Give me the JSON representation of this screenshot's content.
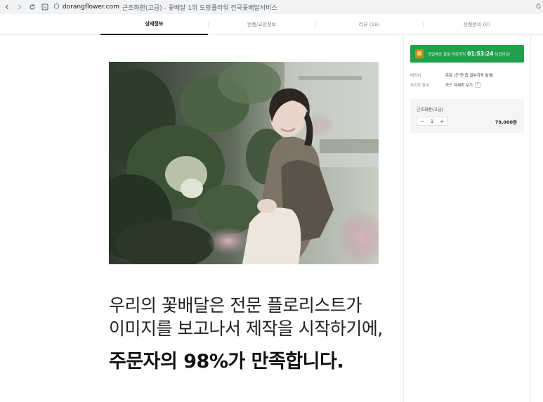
{
  "browser": {
    "domain": "dorangflower.com",
    "tab_title": "근조화환(고급) - 꽃배달 1위 도랑플라워 전국꽃배달서비스",
    "info_icon": "info-icon",
    "edge_letter": "G"
  },
  "tabs": [
    {
      "label": "상세정보",
      "active": true
    },
    {
      "label": "반품/교환정보",
      "active": false
    },
    {
      "label": "리뷰 (18)",
      "active": false
    },
    {
      "label": "상품문의 (0)",
      "active": false
    }
  ],
  "content": {
    "line1": "우리의 꽃배달은 전문 플로리스트가",
    "line2": "이미지를 보고나서 제작을 시작하기에,",
    "line3": "주문자의 98%가 만족합니다."
  },
  "sidebar": {
    "banner_prefix": "당일배송 출발 마감까지",
    "banner_time": "01:53:24",
    "banner_suffix": "남았어요!",
    "shipping_label": "배송비",
    "shipping_value": "무료 (군·면·읍 일부지역 발생)",
    "installment_label": "무이자 할부",
    "installment_value": "카드 자세히 보기",
    "installment_tip": "?",
    "option_name": "근조화환(고급)",
    "quantity": "1",
    "minus": "−",
    "plus": "+",
    "price": "79,000원"
  },
  "colors": {
    "banner_green": "#23a04b",
    "active_tab_border": "#222222"
  }
}
